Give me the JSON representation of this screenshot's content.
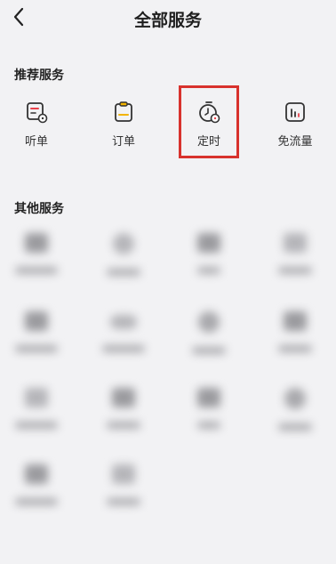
{
  "header": {
    "title": "全部服务",
    "back_icon": "chevron-left-icon"
  },
  "recommended": {
    "title": "推荐服务",
    "items": [
      {
        "label": "听单",
        "icon": "order-list-icon"
      },
      {
        "label": "订单",
        "icon": "clipboard-icon"
      },
      {
        "label": "定时",
        "icon": "timer-icon"
      },
      {
        "label": "免流量",
        "icon": "data-chart-icon"
      }
    ]
  },
  "other": {
    "title": "其他服务",
    "item_count": 14
  },
  "colors": {
    "highlight": "#d8322d",
    "accent": "#e8414b",
    "background": "#f2f2f4"
  }
}
